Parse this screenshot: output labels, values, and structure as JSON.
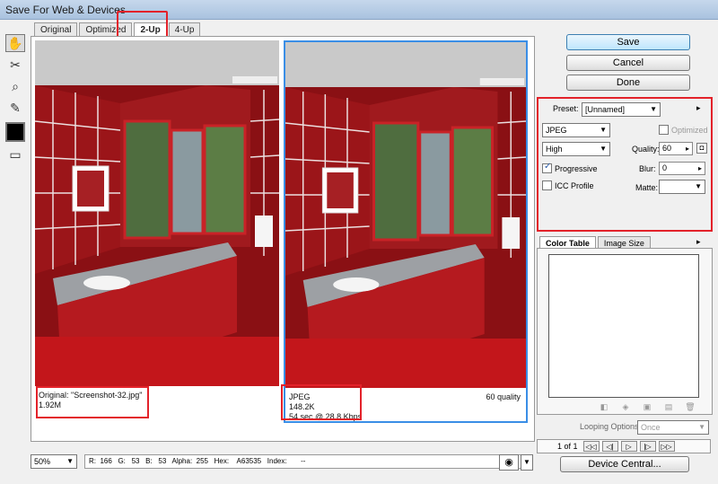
{
  "window": {
    "title": "Save For Web & Devices"
  },
  "tools": [
    {
      "name": "hand-tool-icon",
      "glyph": "✋"
    },
    {
      "name": "slice-select-tool-icon",
      "glyph": "✂"
    },
    {
      "name": "zoom-tool-icon",
      "glyph": "🔍"
    },
    {
      "name": "eyedropper-tool-icon",
      "glyph": "✎"
    }
  ],
  "tabs": [
    {
      "label": "Original",
      "selected": false
    },
    {
      "label": "Optimized",
      "selected": false
    },
    {
      "label": "2-Up",
      "selected": true
    },
    {
      "label": "4-Up",
      "selected": false
    }
  ],
  "left_pane": {
    "line1": "Original: \"Screenshot-32.jpg\"",
    "line2": "1.92M"
  },
  "right_pane": {
    "line1": "JPEG",
    "line2": "148.2K",
    "line3": "54 sec @ 28.8 Kbps",
    "quality_text": "60 quality"
  },
  "buttons": {
    "save": "Save",
    "cancel": "Cancel",
    "done": "Done"
  },
  "settings": {
    "preset_label": "Preset:",
    "preset_value": "[Unnamed]",
    "format_value": "JPEG",
    "optimized_label": "Optimized",
    "compression_value": "High",
    "quality_label": "Quality:",
    "quality_value": "60",
    "progressive_label": "Progressive",
    "blur_label": "Blur:",
    "blur_value": "0",
    "icc_label": "ICC Profile",
    "matte_label": "Matte:"
  },
  "color_table": {
    "tab_color_table": "Color Table",
    "tab_image_size": "Image Size"
  },
  "looping": {
    "label": "Looping Options:",
    "value": "Once"
  },
  "animation": {
    "frame_count": "1 of 1"
  },
  "device_central": "Device Central...",
  "status": {
    "zoom": "50%",
    "pixel_info": "R:  166   G:   53   B:   53   Alpha:  255   Hex:    A63535   Index:       --"
  },
  "colors": {
    "highlight": "#e3222a",
    "selection_border": "#3a8ee6"
  }
}
